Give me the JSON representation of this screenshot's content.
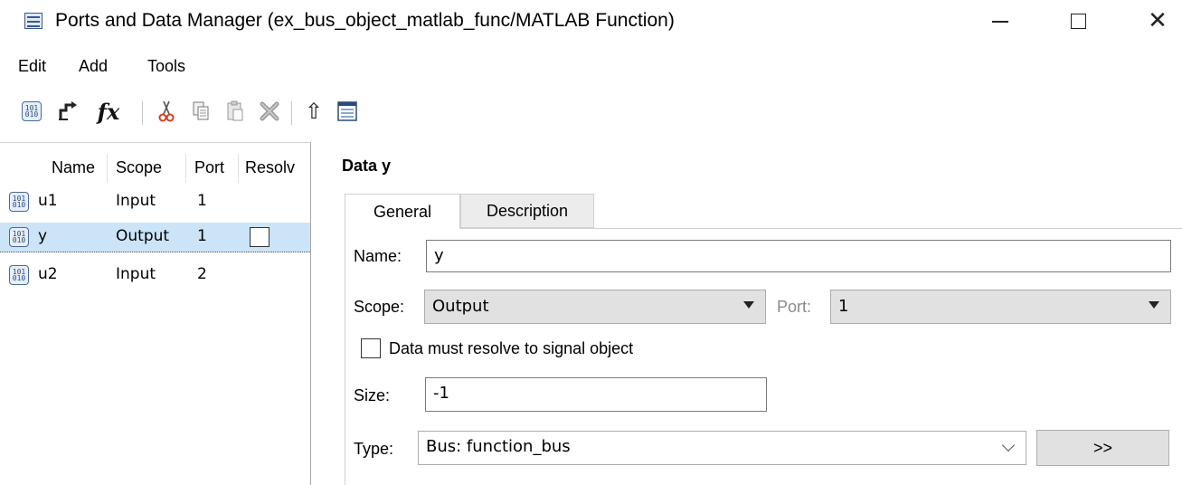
{
  "window": {
    "title": "Ports and Data Manager (ex_bus_object_matlab_func/MATLAB Function)",
    "controls": {
      "minimize_icon": "minimize-icon",
      "maximize_icon": "maximize-icon",
      "close_icon": "close-icon",
      "close_glyph": "✕"
    }
  },
  "menu": {
    "items": [
      "Edit",
      "Add",
      "Tools"
    ]
  },
  "toolbar": {
    "icons": [
      "add-data-icon",
      "add-event-icon",
      "add-function-icon",
      "cut-icon",
      "copy-icon",
      "paste-icon",
      "delete-icon",
      "move-up-icon",
      "model-explorer-icon"
    ],
    "fx_label": "fx",
    "up_glyph": "⇧"
  },
  "data_table": {
    "columns": [
      "Name",
      "Scope",
      "Port",
      "Resolv"
    ],
    "rows": [
      {
        "name": "u1",
        "scope": "Input",
        "port": "1",
        "resolve": null,
        "selected": false
      },
      {
        "name": "y",
        "scope": "Output",
        "port": "1",
        "resolve": false,
        "selected": true
      },
      {
        "name": "u2",
        "scope": "Input",
        "port": "2",
        "resolve": null,
        "selected": false
      }
    ]
  },
  "details": {
    "title": "Data y",
    "tabs": [
      "General",
      "Description"
    ],
    "active_tab": "General",
    "name_label": "Name:",
    "name_value": "y",
    "scope_label": "Scope:",
    "scope_value": "Output",
    "port_label": "Port:",
    "port_value": "1",
    "resolve_label": "Data must resolve to signal object",
    "resolve_checked": false,
    "size_label": "Size:",
    "size_value": "-1",
    "type_label": "Type:",
    "type_value": "Bus: function_bus",
    "type_assistant_label": ">>"
  },
  "colors": {
    "selection": "#cce4f7",
    "disabled_text": "#8a8a8a"
  }
}
